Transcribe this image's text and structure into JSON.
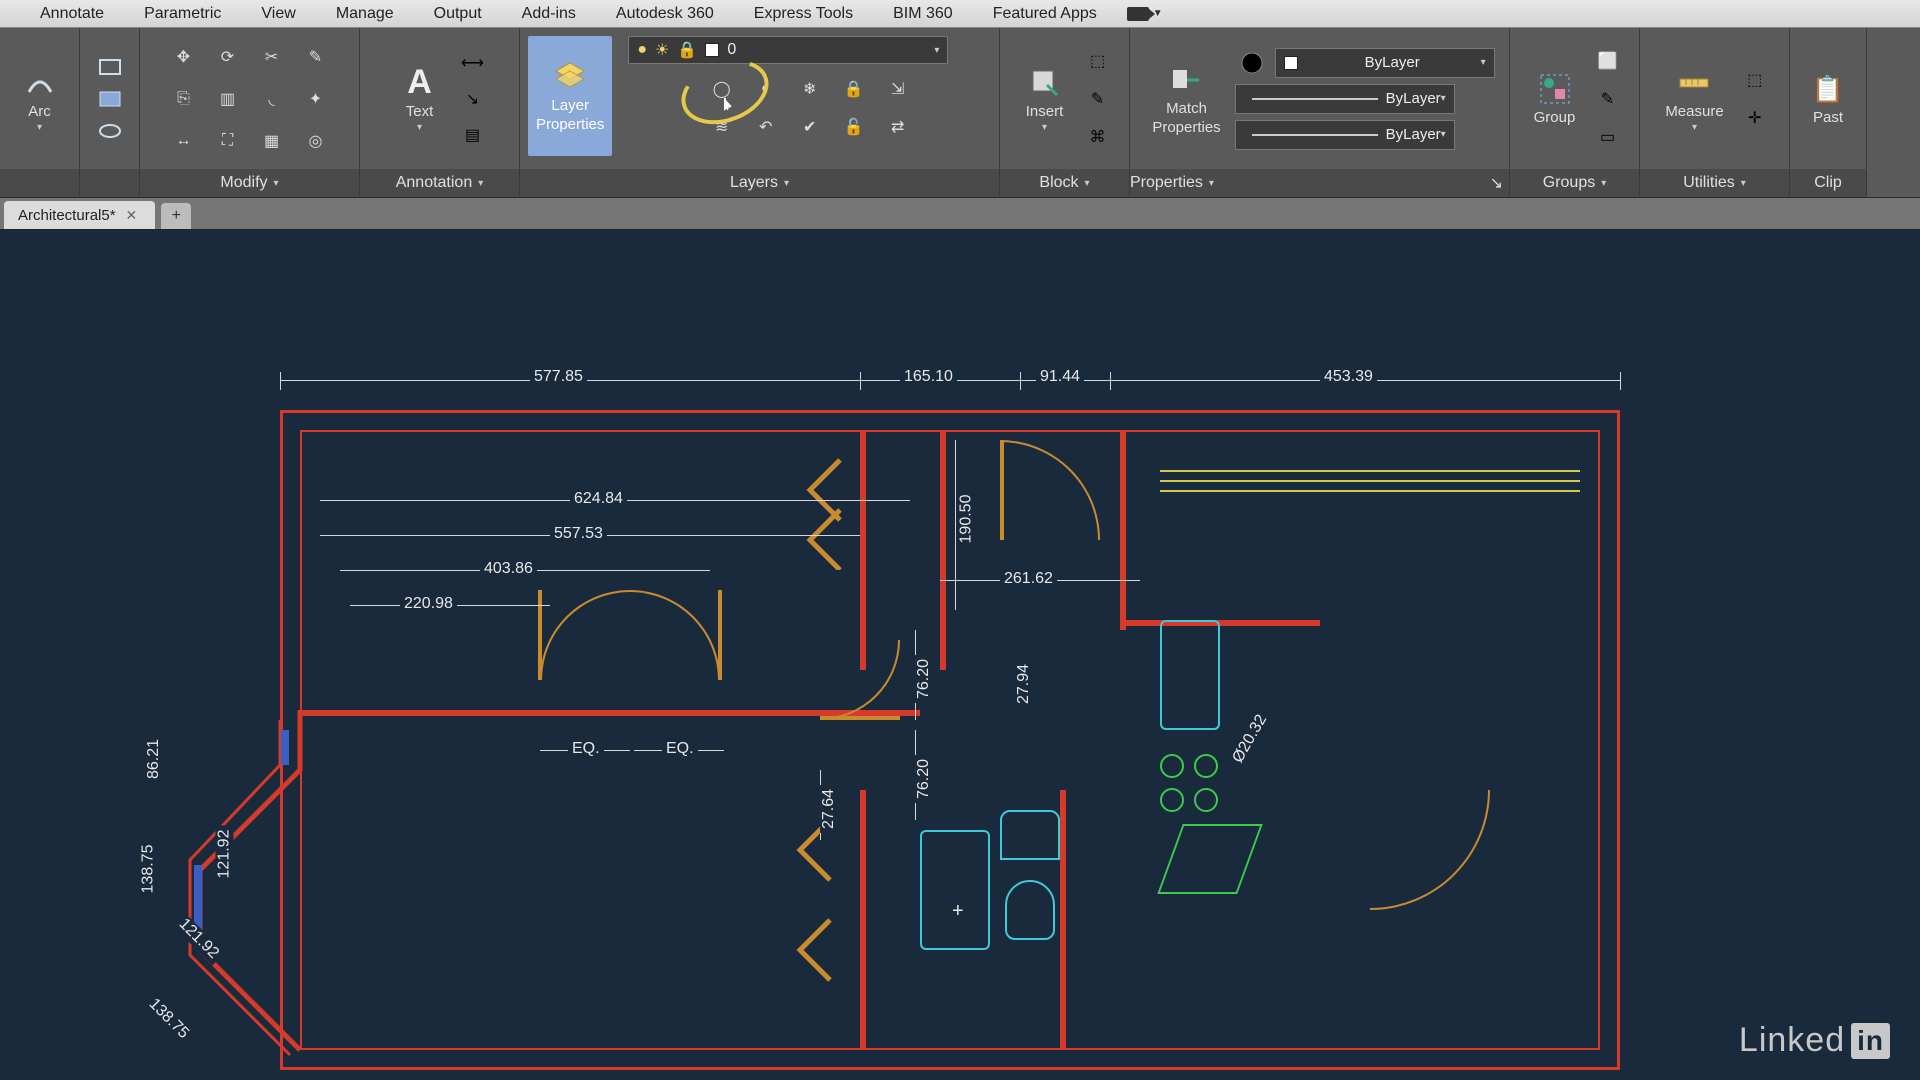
{
  "menu": {
    "items": [
      "Annotate",
      "Parametric",
      "View",
      "Manage",
      "Output",
      "Add-ins",
      "Autodesk 360",
      "Express Tools",
      "BIM 360",
      "Featured Apps"
    ]
  },
  "ribbon": {
    "draw": {
      "arc_label": "Arc"
    },
    "modify": {
      "title": "Modify"
    },
    "annotation": {
      "title": "Annotation",
      "text_label": "Text"
    },
    "layers": {
      "title": "Layers",
      "layerprops_label1": "Layer",
      "layerprops_label2": "Properties",
      "current_layer": "0"
    },
    "block": {
      "title": "Block",
      "insert_label": "Insert"
    },
    "properties": {
      "title": "Properties",
      "match_label1": "Match",
      "match_label2": "Properties",
      "color": "ByLayer",
      "lineweight": "ByLayer",
      "linetype": "ByLayer"
    },
    "groups": {
      "title": "Groups",
      "group_label": "Group"
    },
    "utilities": {
      "title": "Utilities",
      "measure_label": "Measure"
    },
    "clipboard": {
      "title": "Clip",
      "paste_label": "Past"
    }
  },
  "tabs": {
    "active": "Architectural5*"
  },
  "drawing": {
    "dims": {
      "top1": "577.85",
      "top2": "165.10",
      "top3": "91.44",
      "top4": "453.39",
      "h1": "624.84",
      "h2": "557.53",
      "h3": "403.86",
      "h4": "220.98",
      "h5": "261.62",
      "v1": "190.50",
      "v2": "76.20",
      "v3": "27.94",
      "v4": "76.20",
      "v5": "27.64",
      "l1": "86.21",
      "l2": "138.75",
      "l3": "121.92",
      "l4": "121.92",
      "l5": "138.75",
      "d1": "Ø20.32",
      "eq": "EQ."
    }
  },
  "branding": {
    "linkedin": "Linked",
    "in": "in"
  }
}
